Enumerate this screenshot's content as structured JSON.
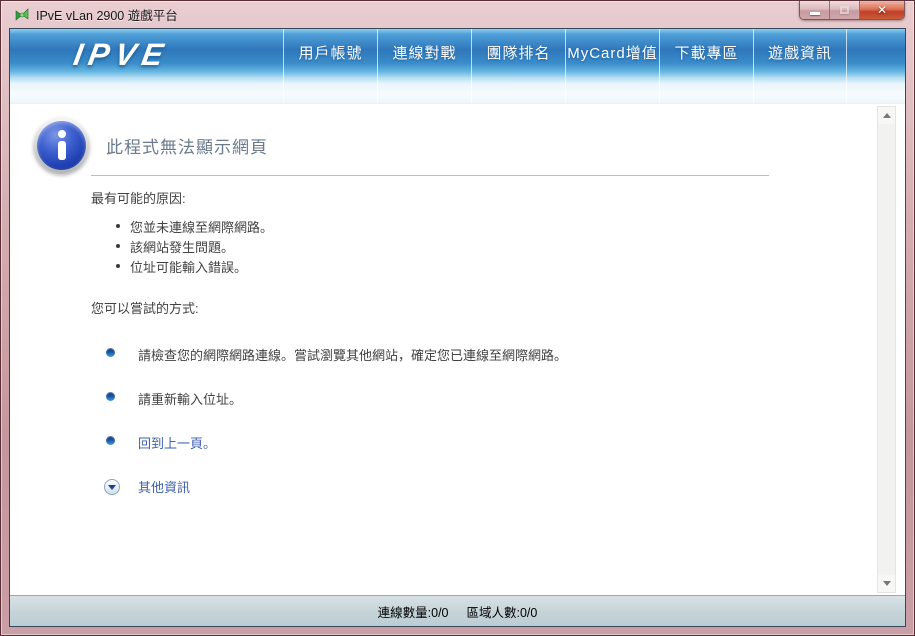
{
  "window": {
    "title": "IPvE vLan 2900 遊戲平台"
  },
  "navbar": {
    "logo_text": "IPVE",
    "items": [
      {
        "label": "用戶帳號"
      },
      {
        "label": "連線對戰"
      },
      {
        "label": "團隊排名"
      },
      {
        "label": "MyCard增值"
      },
      {
        "label": "下載專區"
      },
      {
        "label": "遊戲資訊"
      }
    ]
  },
  "error_page": {
    "title": "此程式無法顯示網頁",
    "causes_heading": "最有可能的原因:",
    "causes": [
      "您並未連線至網際網路。",
      "該網站發生問題。",
      "位址可能輸入錯誤。"
    ],
    "try_heading": "您可以嘗試的方式:",
    "suggestions": [
      {
        "text": "請檢查您的網際網路連線。嘗試瀏覽其他網站，確定您已連線至網際網路。"
      },
      {
        "text": "請重新輸入位址。"
      },
      {
        "text": "回到上一頁。"
      }
    ],
    "more_info": "其他資訊"
  },
  "statusbar": {
    "connections": "連線數量:0/0",
    "players": "區域人數:0/0"
  },
  "colors": {
    "titlebar_rose": "#c79da3",
    "close_red": "#c14f38",
    "nav_blue_dark": "#2f77bb",
    "nav_blue_light": "#eef6fb",
    "heading_gray_blue": "#6b7a8d",
    "body_text": "#414141",
    "link_blue": "#3e5fae",
    "status_bg": "#c5d3d8"
  }
}
